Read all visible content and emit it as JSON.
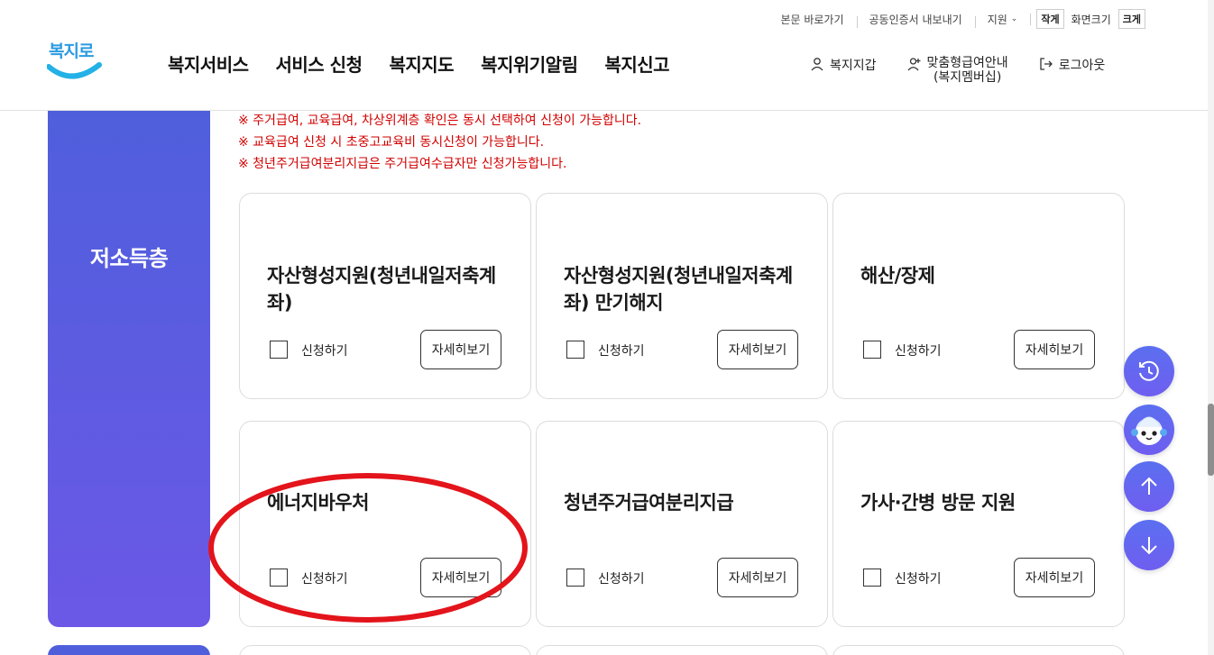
{
  "utility_bar": {
    "skip_link": "본문 바로가기",
    "cert_export": "공동인증서 내보내기",
    "support": "지원",
    "font_small": "작게",
    "font_size_label": "화면크기",
    "font_large": "크게"
  },
  "header": {
    "logo_text": "복지로",
    "nav": [
      "복지서비스",
      "서비스 신청",
      "복지지도",
      "복지위기알림",
      "복지신고"
    ],
    "wallet": "복지지갑",
    "membership_line1": "맞춤형급여안내",
    "membership_line2": "(복지멤버십)",
    "logout": "로그아웃"
  },
  "category": {
    "title": "저소득층"
  },
  "notices": [
    "※ 주거급여, 교육급여, 차상위계층 확인은 동시 선택하여 신청이 가능합니다.",
    "※ 교육급여 신청 시 초중고교육비 동시신청이 가능합니다.",
    "※ 청년주거급여분리지급은 주거급여수급자만 신청가능합니다."
  ],
  "cards": [
    {
      "title": "자산형성지원(청년내일저축계좌)",
      "apply_label": "신청하기",
      "detail_label": "자세히보기"
    },
    {
      "title": "자산형성지원(청년내일저축계좌) 만기해지",
      "apply_label": "신청하기",
      "detail_label": "자세히보기"
    },
    {
      "title": "해산/장제",
      "apply_label": "신청하기",
      "detail_label": "자세히보기"
    },
    {
      "title": "에너지바우처",
      "apply_label": "신청하기",
      "detail_label": "자세히보기"
    },
    {
      "title": "청년주거급여분리지급",
      "apply_label": "신청하기",
      "detail_label": "자세히보기"
    },
    {
      "title": "가사·간병 방문 지원",
      "apply_label": "신청하기",
      "detail_label": "자세히보기"
    }
  ],
  "colors": {
    "accent": "#5b5fe3",
    "notice_red": "#d10000",
    "annotation_red": "#e3141b"
  },
  "floating": {
    "icons": [
      "history-icon",
      "chatbot-icon",
      "arrow-up-icon",
      "arrow-down-icon"
    ]
  }
}
